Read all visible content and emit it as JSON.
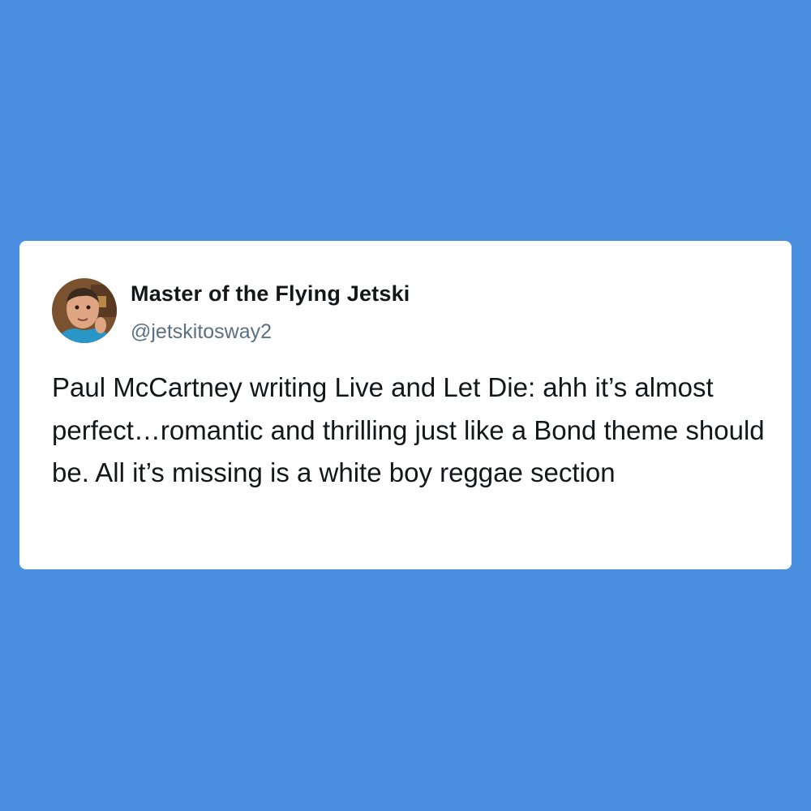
{
  "tweet": {
    "author_name": "Master of the Flying Jetski",
    "handle": "@jetskitosway2",
    "text": "Paul McCartney writing Live and Let Die: ahh it’s almost perfect…romantic and thrilling just like a Bond theme should be. All it’s missing is a white boy reggae section"
  },
  "colors": {
    "background": "#4a8fe0",
    "card": "#ffffff",
    "name_text": "#14171a",
    "handle_text": "#5b7083"
  },
  "icons": {
    "avatar": "profile-photo"
  }
}
